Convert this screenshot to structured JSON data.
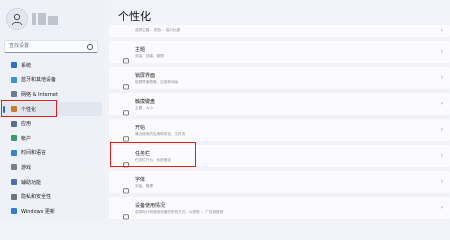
{
  "sidebar": {
    "search_placeholder": "查找设置",
    "items": [
      {
        "label": "系统",
        "icon": "system-icon",
        "color": "#2f6fd3"
      },
      {
        "label": "蓝牙和其他设备",
        "icon": "bluetooth-icon",
        "color": "#3d8de0"
      },
      {
        "label": "网络 & Internet",
        "icon": "network-icon",
        "color": "#6b7c93"
      },
      {
        "label": "个性化",
        "icon": "personalization-brush-icon",
        "color": "#c77c2d"
      },
      {
        "label": "应用",
        "icon": "apps-icon",
        "color": "#5c6f88"
      },
      {
        "label": "帐户",
        "icon": "accounts-icon",
        "color": "#3a9d6a"
      },
      {
        "label": "时间和语言",
        "icon": "time-language-icon",
        "color": "#3b7fcf"
      },
      {
        "label": "游戏",
        "icon": "gaming-icon",
        "color": "#7a7f88"
      },
      {
        "label": "辅助功能",
        "icon": "accessibility-icon",
        "color": "#4a6fb5"
      },
      {
        "label": "隐私和安全性",
        "icon": "privacy-shield-icon",
        "color": "#6d7580"
      },
      {
        "label": "Windows 更新",
        "icon": "windows-update-icon",
        "color": "#2f7fd6"
      }
    ]
  },
  "main": {
    "title": "个性化",
    "cards": [
      {
        "title": "",
        "subtitle": "选择主题... 颜色... 高对比度",
        "icon": "",
        "first": true
      },
      {
        "title": "主题",
        "subtitle": "安装、创建、管理",
        "icon": "themes-brush-icon"
      },
      {
        "title": "锁屏界面",
        "subtitle": "锁屏界面图像、应用和动画",
        "icon": "lock-screen-icon"
      },
      {
        "title": "触摸键盘",
        "subtitle": "主题、大小",
        "icon": "touch-keyboard-icon"
      },
      {
        "title": "开始",
        "subtitle": "最近使用的应用和项目、文件夹",
        "icon": "start-menu-icon"
      },
      {
        "title": "任务栏",
        "subtitle": "任务栏行为、系统固定",
        "icon": "taskbar-icon"
      },
      {
        "title": "字体",
        "subtitle": "安装、管理",
        "icon": "fonts-icon"
      },
      {
        "title": "设备使用情况",
        "subtitle": "选择你计划使用设备的所有方式，以获取 ... 广告和推荐",
        "icon": "device-usage-icon"
      }
    ]
  },
  "colors": {
    "highlight_box": "#e11d1d",
    "accent": "#1a6fd1"
  }
}
